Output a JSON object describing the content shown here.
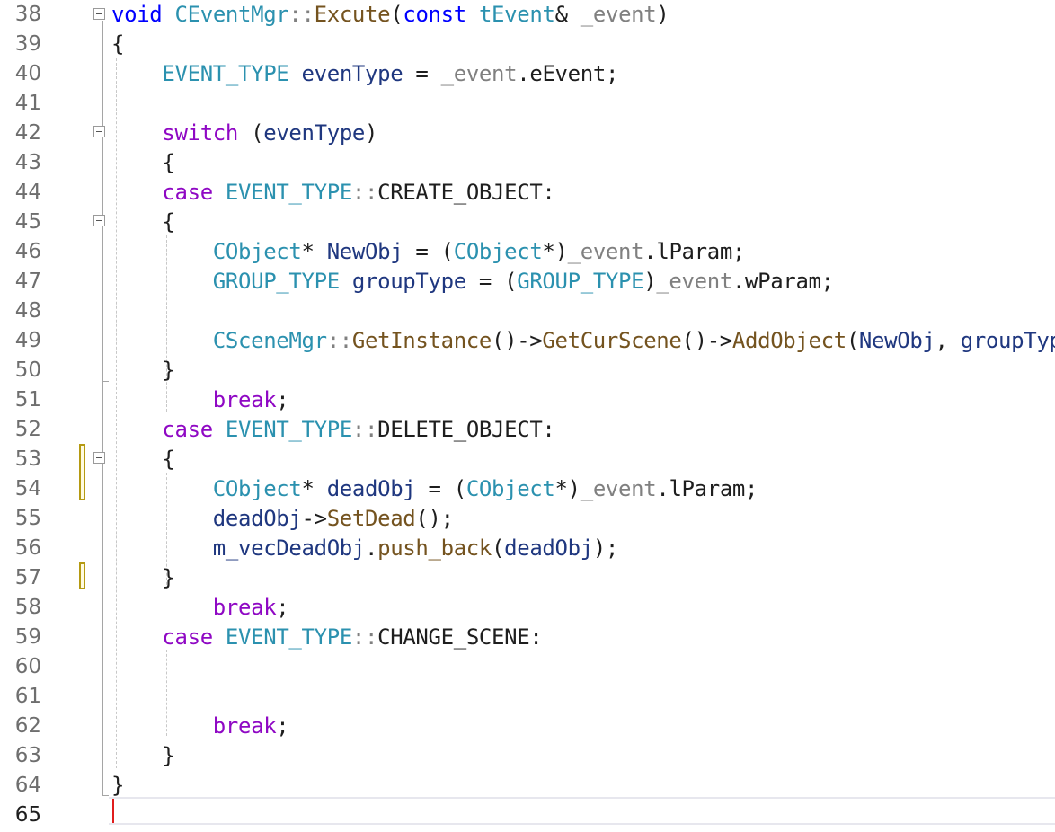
{
  "editor": {
    "current_line": "65",
    "lines": [
      {
        "n": "38",
        "tokens": [
          [
            "kw",
            "void"
          ],
          [
            "pl",
            " "
          ],
          [
            "t",
            "CEventMgr"
          ],
          [
            "p",
            "::"
          ],
          [
            "f",
            "Excute"
          ],
          [
            "pl",
            "("
          ],
          [
            "kw",
            "const"
          ],
          [
            "pl",
            " "
          ],
          [
            "t",
            "tEvent"
          ],
          [
            "pl",
            "& "
          ],
          [
            "p",
            "_event"
          ],
          [
            "pl",
            ")"
          ]
        ]
      },
      {
        "n": "39",
        "tokens": [
          [
            "pl",
            "{"
          ]
        ]
      },
      {
        "n": "40",
        "tokens": [
          [
            "pl",
            "    "
          ],
          [
            "t",
            "EVENT_TYPE"
          ],
          [
            "pl",
            " "
          ],
          [
            "v",
            "evenType"
          ],
          [
            "pl",
            " = "
          ],
          [
            "p",
            "_event"
          ],
          [
            "pl",
            "."
          ],
          [
            "mem",
            "eEvent"
          ],
          [
            "pl",
            ";"
          ]
        ]
      },
      {
        "n": "41",
        "tokens": []
      },
      {
        "n": "42",
        "tokens": [
          [
            "pl",
            "    "
          ],
          [
            "k",
            "switch"
          ],
          [
            "pl",
            " ("
          ],
          [
            "v",
            "evenType"
          ],
          [
            "pl",
            ")"
          ]
        ]
      },
      {
        "n": "43",
        "tokens": [
          [
            "pl",
            "    {"
          ]
        ]
      },
      {
        "n": "44",
        "tokens": [
          [
            "pl",
            "    "
          ],
          [
            "k",
            "case"
          ],
          [
            "pl",
            " "
          ],
          [
            "t",
            "EVENT_TYPE"
          ],
          [
            "p",
            "::"
          ],
          [
            "pl",
            "CREATE_OBJECT:"
          ]
        ]
      },
      {
        "n": "45",
        "tokens": [
          [
            "pl",
            "    {"
          ]
        ]
      },
      {
        "n": "46",
        "tokens": [
          [
            "pl",
            "        "
          ],
          [
            "t",
            "CObject"
          ],
          [
            "pl",
            "* "
          ],
          [
            "v",
            "NewObj"
          ],
          [
            "pl",
            " = ("
          ],
          [
            "t",
            "CObject"
          ],
          [
            "pl",
            "*)"
          ],
          [
            "p",
            "_event"
          ],
          [
            "pl",
            "."
          ],
          [
            "mem",
            "lParam"
          ],
          [
            "pl",
            ";"
          ]
        ]
      },
      {
        "n": "47",
        "tokens": [
          [
            "pl",
            "        "
          ],
          [
            "t",
            "GROUP_TYPE"
          ],
          [
            "pl",
            " "
          ],
          [
            "v",
            "groupType"
          ],
          [
            "pl",
            " = ("
          ],
          [
            "t",
            "GROUP_TYPE"
          ],
          [
            "pl",
            ")"
          ],
          [
            "p",
            "_event"
          ],
          [
            "pl",
            "."
          ],
          [
            "mem",
            "wParam"
          ],
          [
            "pl",
            ";"
          ]
        ]
      },
      {
        "n": "48",
        "tokens": []
      },
      {
        "n": "49",
        "tokens": [
          [
            "pl",
            "        "
          ],
          [
            "t",
            "CSceneMgr"
          ],
          [
            "p",
            "::"
          ],
          [
            "f",
            "GetInstance"
          ],
          [
            "pl",
            "()->"
          ],
          [
            "f",
            "GetCurScene"
          ],
          [
            "pl",
            "()->"
          ],
          [
            "f",
            "AddObject"
          ],
          [
            "pl",
            "("
          ],
          [
            "v",
            "NewObj"
          ],
          [
            "pl",
            ", "
          ],
          [
            "v",
            "groupType"
          ],
          [
            "pl",
            ");"
          ]
        ]
      },
      {
        "n": "50",
        "tokens": [
          [
            "pl",
            "    }"
          ]
        ]
      },
      {
        "n": "51",
        "tokens": [
          [
            "pl",
            "        "
          ],
          [
            "k",
            "break"
          ],
          [
            "pl",
            ";"
          ]
        ]
      },
      {
        "n": "52",
        "tokens": [
          [
            "pl",
            "    "
          ],
          [
            "k",
            "case"
          ],
          [
            "pl",
            " "
          ],
          [
            "t",
            "EVENT_TYPE"
          ],
          [
            "p",
            "::"
          ],
          [
            "pl",
            "DELETE_OBJECT:"
          ]
        ]
      },
      {
        "n": "53",
        "tokens": [
          [
            "pl",
            "    {"
          ]
        ]
      },
      {
        "n": "54",
        "tokens": [
          [
            "pl",
            "        "
          ],
          [
            "t",
            "CObject"
          ],
          [
            "pl",
            "* "
          ],
          [
            "v",
            "deadObj"
          ],
          [
            "pl",
            " = ("
          ],
          [
            "t",
            "CObject"
          ],
          [
            "pl",
            "*)"
          ],
          [
            "p",
            "_event"
          ],
          [
            "pl",
            "."
          ],
          [
            "mem",
            "lParam"
          ],
          [
            "pl",
            ";"
          ]
        ]
      },
      {
        "n": "55",
        "tokens": [
          [
            "pl",
            "        "
          ],
          [
            "v",
            "deadObj"
          ],
          [
            "pl",
            "->"
          ],
          [
            "f",
            "SetDead"
          ],
          [
            "pl",
            "();"
          ]
        ]
      },
      {
        "n": "56",
        "tokens": [
          [
            "pl",
            "        "
          ],
          [
            "v",
            "m_vecDeadObj"
          ],
          [
            "pl",
            "."
          ],
          [
            "f",
            "push_back"
          ],
          [
            "pl",
            "("
          ],
          [
            "v",
            "deadObj"
          ],
          [
            "pl",
            ");"
          ]
        ]
      },
      {
        "n": "57",
        "tokens": [
          [
            "pl",
            "    }"
          ]
        ]
      },
      {
        "n": "58",
        "tokens": [
          [
            "pl",
            "        "
          ],
          [
            "k",
            "break"
          ],
          [
            "pl",
            ";"
          ]
        ]
      },
      {
        "n": "59",
        "tokens": [
          [
            "pl",
            "    "
          ],
          [
            "k",
            "case"
          ],
          [
            "pl",
            " "
          ],
          [
            "t",
            "EVENT_TYPE"
          ],
          [
            "p",
            "::"
          ],
          [
            "pl",
            "CHANGE_SCENE:"
          ]
        ]
      },
      {
        "n": "60",
        "tokens": []
      },
      {
        "n": "61",
        "tokens": []
      },
      {
        "n": "62",
        "tokens": [
          [
            "pl",
            "        "
          ],
          [
            "k",
            "break"
          ],
          [
            "pl",
            ";"
          ]
        ]
      },
      {
        "n": "63",
        "tokens": [
          [
            "pl",
            "    }"
          ]
        ]
      },
      {
        "n": "64",
        "tokens": [
          [
            "pl",
            "}"
          ]
        ]
      },
      {
        "n": "65",
        "tokens": []
      }
    ]
  }
}
